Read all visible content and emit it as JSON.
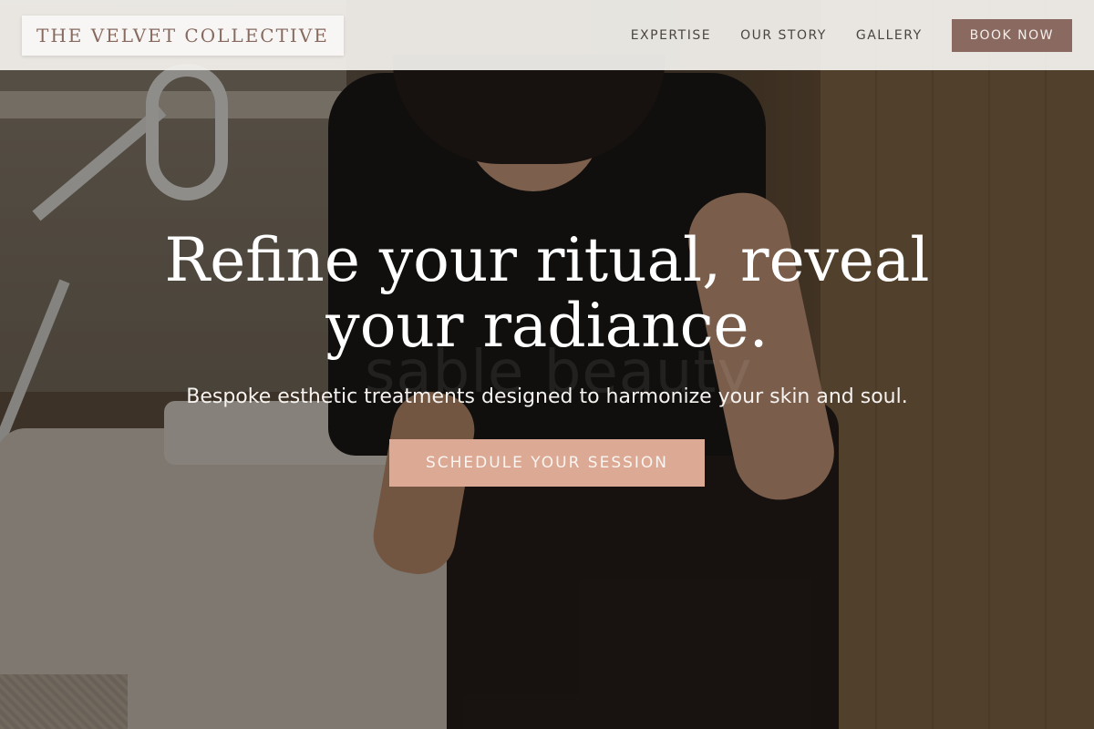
{
  "brand": {
    "name": "THE VELVET COLLECTIVE"
  },
  "nav": {
    "items": [
      {
        "label": "EXPERTISE"
      },
      {
        "label": "OUR STORY"
      },
      {
        "label": "GALLERY"
      }
    ],
    "book_label": "BOOK NOW"
  },
  "hero": {
    "headline": "Refine your ritual, reveal your radiance.",
    "subheadline": "Bespoke esthetic treatments designed to harmonize your skin and soul.",
    "cta_label": "SCHEDULE YOUR SESSION",
    "watermark": "sable beauty"
  },
  "colors": {
    "header_bg": "#f4f2ee",
    "brand_text": "#866a60",
    "book_button": "#8a6a60",
    "cta_button": "#dca994"
  }
}
